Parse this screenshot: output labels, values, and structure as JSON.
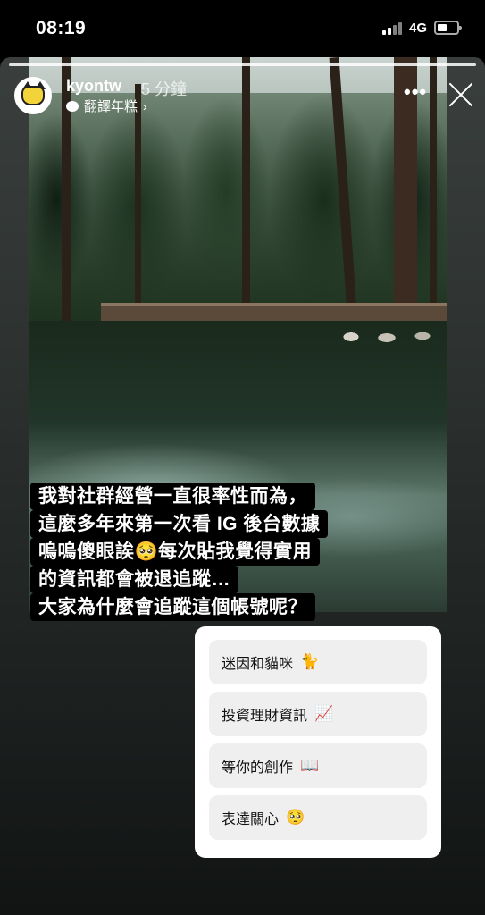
{
  "status_bar": {
    "time": "08:19",
    "network": "4G"
  },
  "story": {
    "username": "kyontw",
    "time_ago": "5 分鐘",
    "subtitle": "翻譯年糕",
    "caption_lines": [
      "我對社群經營一直很率性而為，",
      "這麼多年來第一次看 IG 後台數據",
      "嗚嗚傻眼誒🥺每次貼我覺得實用",
      "的資訊都會被退追蹤…",
      "大家為什麼會追蹤這個帳號呢？"
    ],
    "poll_options": [
      {
        "label": "迷因和貓咪",
        "emoji": "🐈"
      },
      {
        "label": "投資理財資訊",
        "emoji": "📈"
      },
      {
        "label": "等你的創作",
        "emoji": "📖"
      },
      {
        "label": "表達關心",
        "emoji": "🥺"
      }
    ]
  }
}
